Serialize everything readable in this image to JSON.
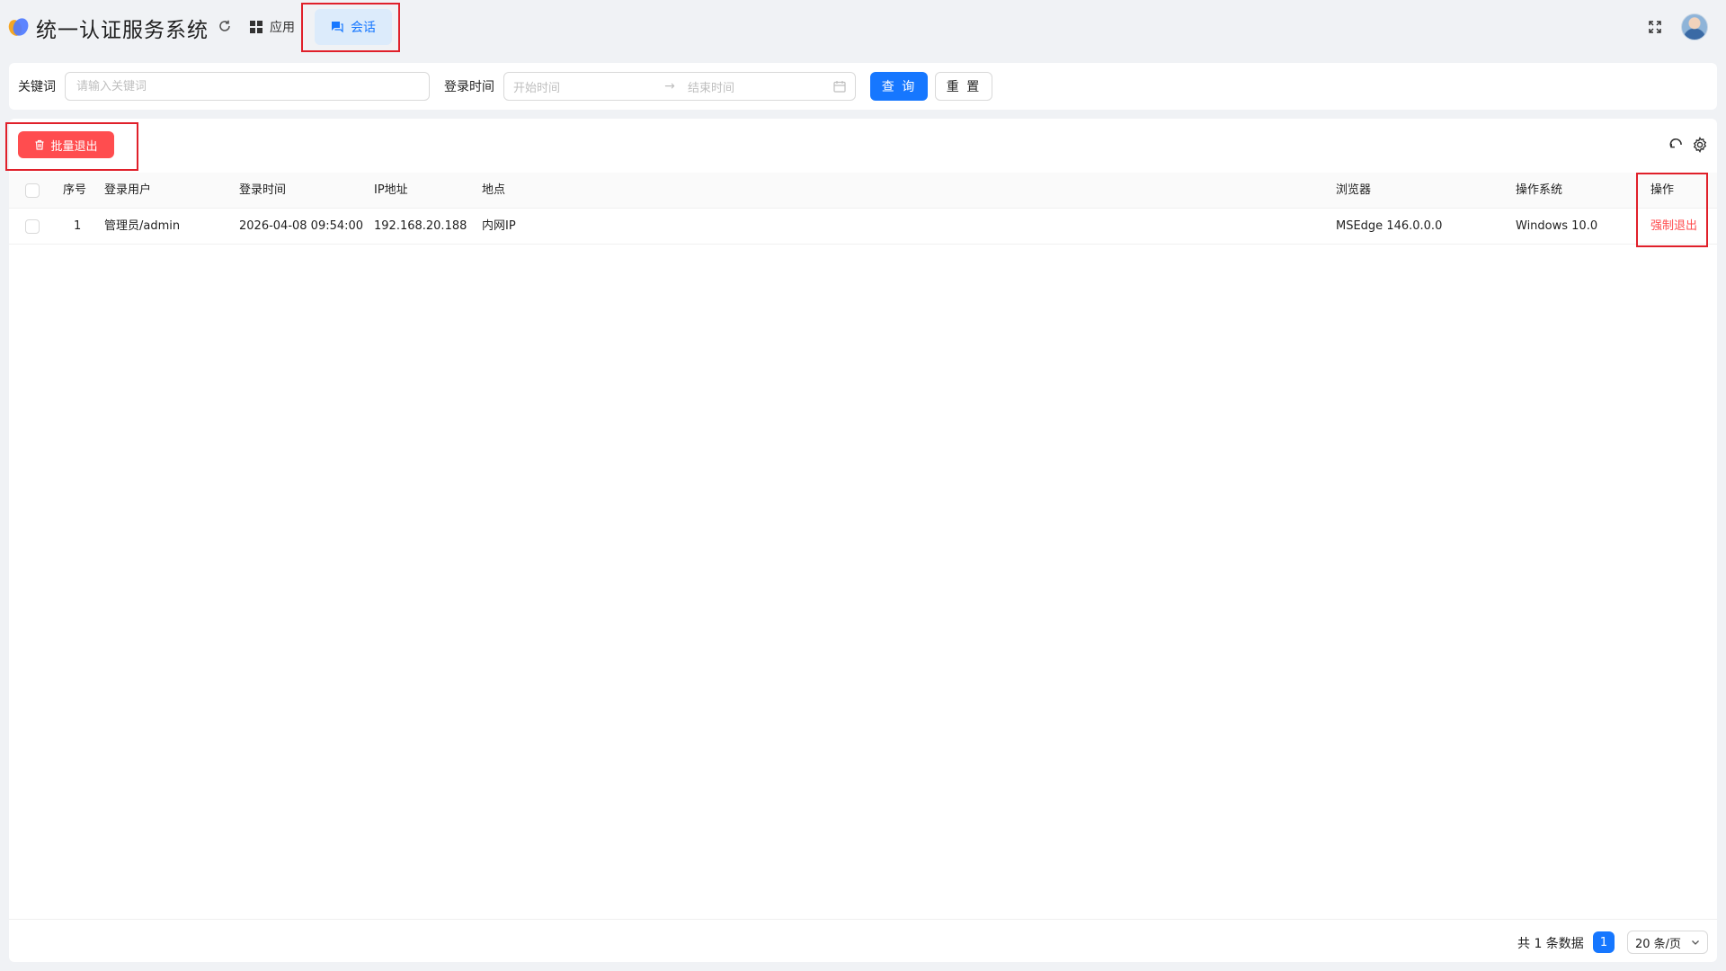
{
  "app": {
    "title": "统一认证服务系统",
    "logo_icon": "app-logo-icon"
  },
  "nav": {
    "refresh_icon": "refresh-icon",
    "items": [
      {
        "label": "应用",
        "icon": "grid-icon"
      },
      {
        "label": "会话",
        "icon": "chat-icon",
        "active": true
      }
    ],
    "fullscreen_icon": "fullscreen-icon"
  },
  "filters": {
    "keyword_label": "关键词",
    "keyword_placeholder": "请输入关键词",
    "keyword_value": "",
    "login_time_label": "登录时间",
    "start_placeholder": "开始时间",
    "range_separator": "→",
    "end_placeholder": "结束时间",
    "query_label": "查 询",
    "reset_label": "重 置"
  },
  "toolbar": {
    "batch_logout_label": "批量退出"
  },
  "table": {
    "columns": [
      "序号",
      "登录用户",
      "登录时间",
      "IP地址",
      "地点",
      "浏览器",
      "操作系统",
      "操作"
    ],
    "rows": [
      {
        "index": "1",
        "user": "管理员/admin",
        "login_time": "2026-04-08 09:54:00",
        "ip": "192.168.20.188",
        "location": "内网IP",
        "browser": "MSEdge 146.0.0.0",
        "os": "Windows 10.0",
        "action": "强制退出"
      }
    ]
  },
  "pagination": {
    "total_text": "共 1 条数据",
    "current_page": "1",
    "page_size": "20 条/页"
  },
  "colors": {
    "primary": "#1677ff",
    "danger": "#ff4d4f",
    "annotation": "#e0202a",
    "active_nav_bg": "#dcebfb"
  }
}
